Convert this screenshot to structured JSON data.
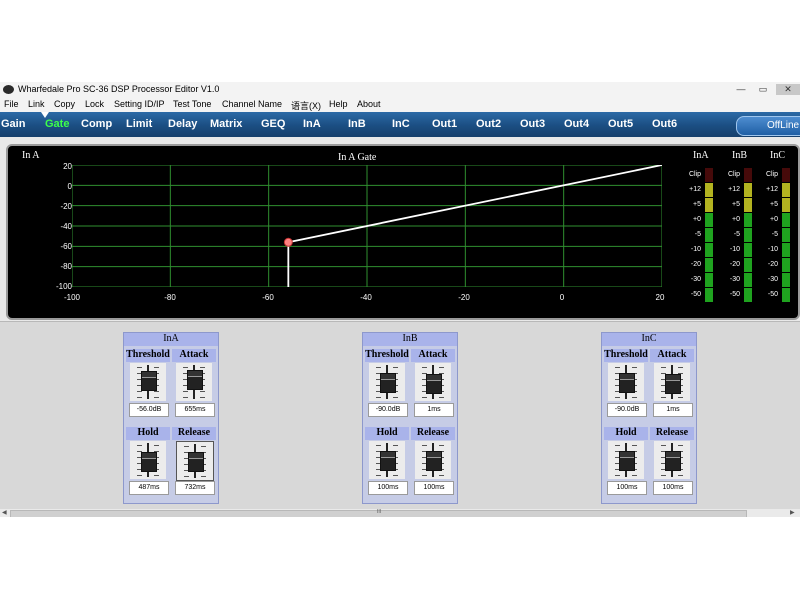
{
  "window": {
    "title": "Wharfedale Pro SC-36 DSP Processor Editor V1.0"
  },
  "window_controls": {
    "minimize": "—",
    "maximize": "▭",
    "close": "✕"
  },
  "menu": [
    "File",
    "Link",
    "Copy",
    "Lock",
    "Setting ID/IP",
    "Test Tone",
    "Channel Name",
    "语言(X)",
    "Help",
    "About"
  ],
  "tabs": [
    "Gain",
    "Gate",
    "Comp",
    "Limit",
    "Delay",
    "Matrix",
    "GEQ",
    "InA",
    "InB",
    "InC",
    "Out1",
    "Out2",
    "Out3",
    "Out4",
    "Out5",
    "Out6"
  ],
  "active_tab": "Gate",
  "offline_button": "OffLine",
  "graph": {
    "channel_label": "In A",
    "title": "In A  Gate",
    "y_ticks": [
      "20",
      "0",
      "-20",
      "-40",
      "-60",
      "-80",
      "-100"
    ],
    "x_ticks": [
      "-100",
      "-80",
      "-60",
      "-40",
      "-20",
      "0",
      "20"
    ],
    "grid_color": "#2f8f2f",
    "line_color": "#ffffff",
    "point_color": "#ff8080"
  },
  "chart_data": {
    "type": "line",
    "title": "In A  Gate",
    "x": [
      -56,
      -56,
      20
    ],
    "y": [
      -100,
      -56,
      20
    ],
    "xlim": [
      -100,
      20
    ],
    "ylim": [
      -100,
      20
    ],
    "grid": true,
    "threshold_point": {
      "x": -56,
      "y": -56
    }
  },
  "meter_scale": [
    "Clip",
    "+12",
    "+5",
    "+0",
    "-5",
    "-10",
    "-20",
    "-30",
    "-50"
  ],
  "meters": [
    {
      "label": "InA",
      "level_db": 12
    },
    {
      "label": "InB",
      "level_db": 12
    },
    {
      "label": "InC",
      "level_db": 12
    }
  ],
  "meter_colors": {
    "clip": "#c81e1e",
    "high": "#b3b320",
    "normal": "#1fa31f"
  },
  "channels": [
    {
      "name": "InA",
      "threshold": "-56.0dB",
      "attack": "655ms",
      "hold": "487ms",
      "release": "732ms"
    },
    {
      "name": "InB",
      "threshold": "-90.0dB",
      "attack": "1ms",
      "hold": "100ms",
      "release": "100ms"
    },
    {
      "name": "InC",
      "threshold": "-90.0dB",
      "attack": "1ms",
      "hold": "100ms",
      "release": "100ms"
    }
  ],
  "param_labels": {
    "threshold": "Threshold",
    "attack": "Attack",
    "hold": "Hold",
    "release": "Release"
  },
  "fader_levels": [
    {
      "threshold": 0.55,
      "attack": 0.62,
      "hold": 0.4,
      "release": 0.45
    },
    {
      "threshold": 0.45,
      "attack": 0.4,
      "hold": 0.42,
      "release": 0.42
    },
    {
      "threshold": 0.45,
      "attack": 0.4,
      "hold": 0.42,
      "release": 0.42
    }
  ],
  "scrollbar": {
    "grip": "III"
  }
}
